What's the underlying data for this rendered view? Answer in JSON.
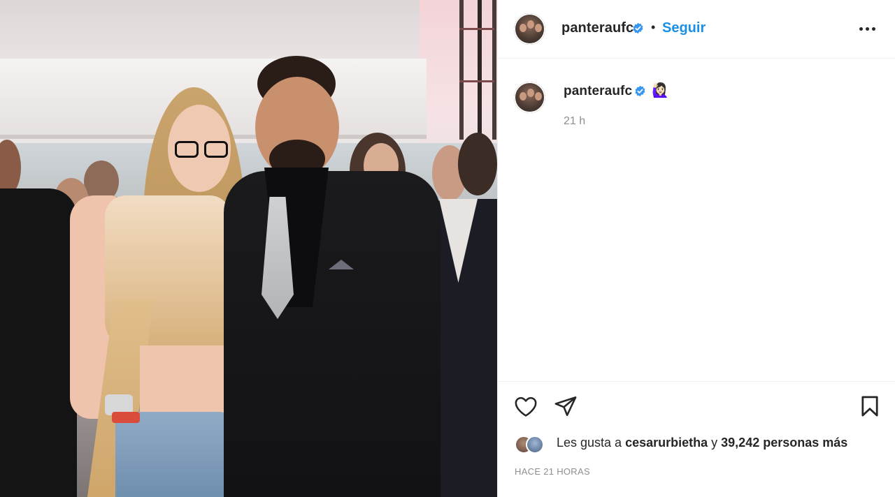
{
  "post": {
    "username": "panteraufc",
    "follow_label": "Seguir",
    "separator": "•",
    "caption_emoji": "🙋🏻‍♀️",
    "caption_time": "21 h",
    "likes": {
      "prefix": "Les gusta a ",
      "first_user": "cesarurbietha",
      "middle": " y ",
      "count": "39,242",
      "suffix": " personas más"
    },
    "posted_time": "HACE 21 HORAS"
  },
  "icons": {
    "verified": "verified-badge-icon",
    "like": "heart-icon",
    "share": "paper-plane-icon",
    "save": "bookmark-icon",
    "more": "more-options-icon"
  },
  "colors": {
    "follow": "#1a8fe3",
    "verified": "#3897f0",
    "muted": "#8e8e8e"
  }
}
